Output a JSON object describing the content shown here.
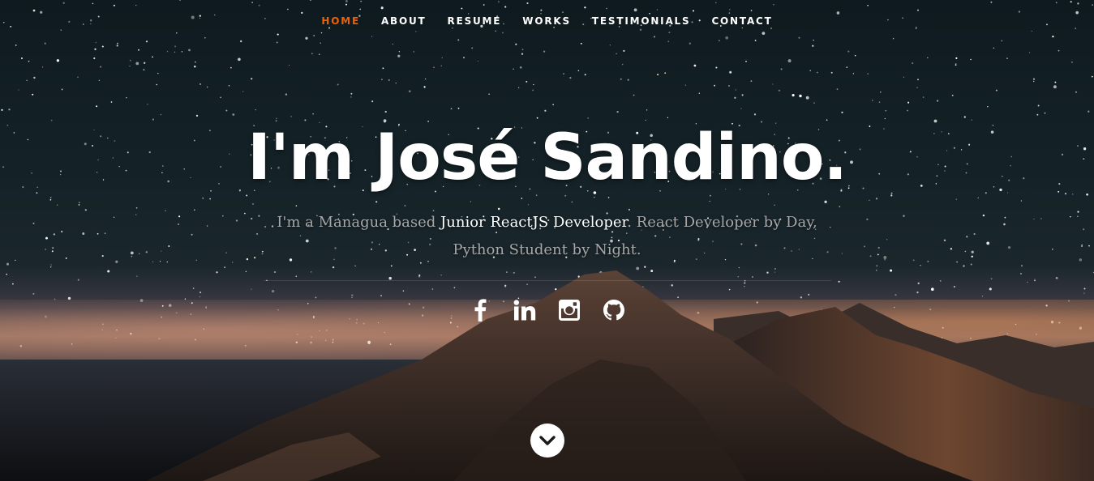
{
  "nav": {
    "items": [
      {
        "label": "HOME",
        "active": true
      },
      {
        "label": "ABOUT",
        "active": false
      },
      {
        "label": "RESUME",
        "active": false
      },
      {
        "label": "WORKS",
        "active": false
      },
      {
        "label": "TESTIMONIALS",
        "active": false
      },
      {
        "label": "CONTACT",
        "active": false
      }
    ],
    "active_color": "#f06000"
  },
  "banner": {
    "headline": "I'm José Sandino.",
    "intro_prefix": "I'm a Managua based ",
    "intro_highlight": "Junior ReactJS Developer",
    "intro_suffix": ". React Developer by Day, Python Student by Night."
  },
  "social": [
    {
      "icon": "facebook-icon"
    },
    {
      "icon": "linkedin-icon"
    },
    {
      "icon": "instagram-icon"
    },
    {
      "icon": "github-icon"
    }
  ],
  "scroll": {
    "icon": "chevron-down-icon"
  }
}
